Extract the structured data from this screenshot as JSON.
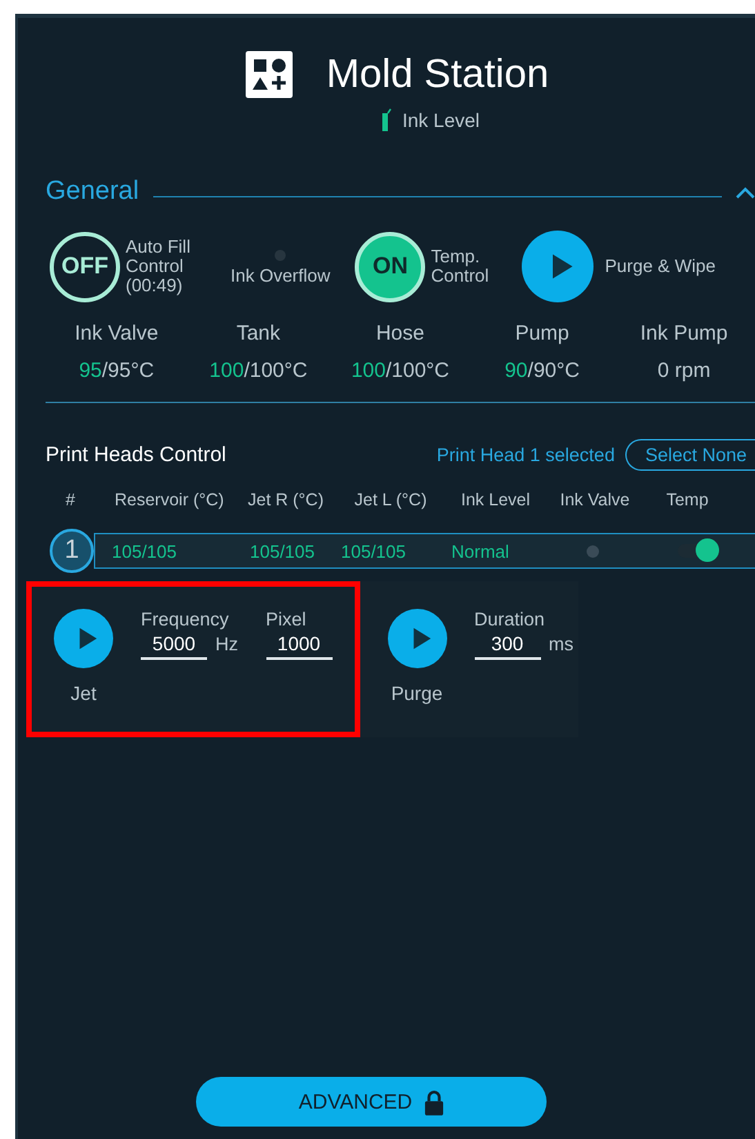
{
  "header": {
    "title": "Mold Station",
    "subtitle": "Ink Level"
  },
  "general": {
    "title": "General",
    "expanded": true,
    "controls": [
      {
        "kind": "toggle",
        "on": false,
        "state_label": "OFF",
        "label": "Auto Fill Control (00:49)"
      },
      {
        "kind": "indicator",
        "on": false,
        "label": "Ink Overflow"
      },
      {
        "kind": "toggle",
        "on": true,
        "state_label": "ON",
        "label": "Temp. Control"
      },
      {
        "kind": "action",
        "label": "Purge & Wipe"
      }
    ],
    "readings": [
      {
        "label": "Ink Valve",
        "actual": "95",
        "target": "/95°C"
      },
      {
        "label": "Tank",
        "actual": "100",
        "target": "/100°C"
      },
      {
        "label": "Hose",
        "actual": "100",
        "target": "/100°C"
      },
      {
        "label": "Pump",
        "actual": "90",
        "target": "/90°C"
      },
      {
        "label": "Ink Pump",
        "target": "0 rpm"
      }
    ]
  },
  "print_heads": {
    "title": "Print Heads Control",
    "selection_text": "Print Head 1 selected",
    "select_none": "Select None",
    "columns": [
      "#",
      "Reservoir (°C)",
      "Jet R (°C)",
      "Jet L (°C)",
      "Ink Level",
      "Ink Valve",
      "Temp"
    ],
    "rows": [
      {
        "number": "1",
        "selected": true,
        "reservoir": "105/105",
        "jet_r": "105/105",
        "jet_l": "105/105",
        "ink_level": "Normal",
        "ink_valve": false,
        "temp": true
      }
    ]
  },
  "actions": [
    {
      "label": "Jet",
      "highlighted": true,
      "fields": [
        {
          "label": "Frequency",
          "value": "5000",
          "unit": "Hz"
        },
        {
          "label": "Pixel",
          "value": "1000"
        }
      ]
    },
    {
      "label": "Purge",
      "highlighted": false,
      "fields": [
        {
          "label": "Duration",
          "value": "300",
          "unit": "ms"
        }
      ]
    }
  ],
  "advanced": {
    "label": "ADVANCED",
    "locked": true
  }
}
